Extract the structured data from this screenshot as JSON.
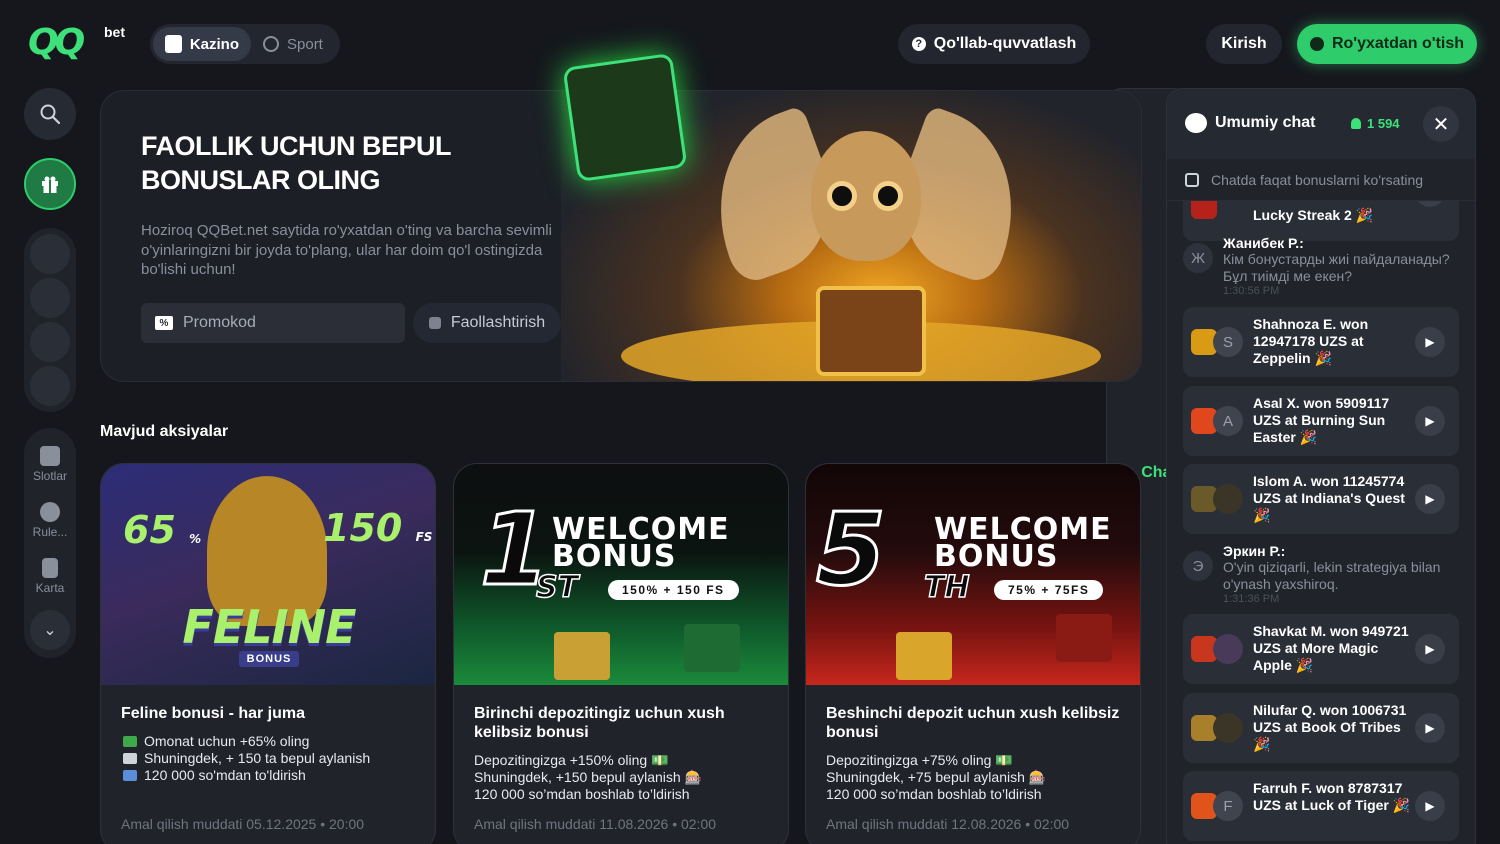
{
  "logo": {
    "brand": "QQ",
    "suffix": "bet"
  },
  "modes": [
    {
      "label": "Kazino",
      "active": true,
      "icon": "cards-icon"
    },
    {
      "label": "Sport",
      "active": false,
      "icon": "ball-icon"
    }
  ],
  "header": {
    "support_label": "Qo'llab-quvvatlash",
    "chat_label": "Chat",
    "login_label": "Kirish",
    "register_label": "Ro'yxatdan o'tish"
  },
  "sidebar": {
    "items": [
      {
        "label": "Slotlar",
        "icon": "slot-icon"
      },
      {
        "label": "Rule...",
        "icon": "roulette-icon"
      },
      {
        "label": "Karta",
        "icon": "card-icon"
      }
    ]
  },
  "hero": {
    "title": "FAOLLIK UCHUN BEPUL BONUSLAR OLING",
    "description": "Hoziroq QQBet.net saytida ro'yxatdan o'ting va barcha sevimli o'yinlaringizni bir joyda to'plang, ular har doim qo'l ostingizda bo'lishi uchun!",
    "promo_placeholder": "Promokod",
    "activate_label": "Faollashtirish"
  },
  "promotions": {
    "section_title": "Mavjud aksiyalar",
    "cards": [
      {
        "art": {
          "left": "65",
          "left_unit": "%",
          "right": "150",
          "right_unit": "FS",
          "name": "FELINE",
          "tag": "BONUS"
        },
        "title": "Feline bonusi - har juma",
        "lines": [
          "Omonat uchun +65% oling",
          "Shuningdek, + 150 ta bepul aylanish",
          "120 000 so'mdan to'ldirish"
        ],
        "deadline": "Amal qilish muddati 05.12.2025 • 20:00"
      },
      {
        "art": {
          "num": "1",
          "ordinal": "ST",
          "line1": "WELCOME",
          "line2": "BONUS",
          "pill": "150% + 150 FS"
        },
        "title": "Birinchi depozitingiz uchun xush kelibsiz bonusi",
        "lines": [
          "Depozitingizga +150% oling 💵",
          "Shuningdek, +150 bepul aylanish 🎰",
          "120 000 so’mdan boshlab to’ldirish"
        ],
        "deadline": "Amal qilish muddati 11.08.2026 • 02:00"
      },
      {
        "art": {
          "num": "5",
          "ordinal": "TH",
          "line1": "WELCOME",
          "line2": "BONUS",
          "pill": "75% + 75FS"
        },
        "title": "Beshinchi depozit uchun xush kelibsiz bonusi",
        "lines": [
          "Depozitingizga +75% oling 💵",
          "Shuningdek, +75 bepul aylanish 🎰",
          "120 000 so’mdan boshlab to’ldirish"
        ],
        "deadline": "Amal qilish muddati 12.08.2026 • 02:00"
      }
    ]
  },
  "chat": {
    "title": "Umumiy chat",
    "online_count": "1 594",
    "filter_label": "Chatda faqat bonuslarni ko'rsating",
    "feed": [
      {
        "type": "win",
        "text": "Lucky Streak 2 🎉",
        "initial": "",
        "thumb": "#b4221a"
      },
      {
        "type": "msg",
        "initial": "Ж",
        "name": "Жанибек Р.:",
        "text": "Кім бонустарды жиі пайдаланады? Бұл тиімді ме екен?",
        "time": "1:30:56 PM"
      },
      {
        "type": "win",
        "text": "Shahnoza E. won 12947178 UZS at Zeppelin 🎉",
        "initial": "S",
        "thumb": "#d99a14"
      },
      {
        "type": "win",
        "text": "Asal X. won 5909117 UZS at Burning Sun Easter 🎉",
        "initial": "A",
        "thumb": "#e0471c"
      },
      {
        "type": "win",
        "text": "Islom A. won 11245774 UZS at Indiana's Quest 🎉",
        "initial": "",
        "thumb": "#6a5a2a"
      },
      {
        "type": "msg",
        "initial": "Э",
        "name": "Эркин Р.:",
        "text": "O'yin qiziqarli, lekin strategiya bilan o'ynash yaxshiroq.",
        "time": "1:31:36 PM"
      },
      {
        "type": "win",
        "text": "Shavkat M. won 949721 UZS at More Magic Apple 🎉",
        "initial": "",
        "thumb": "#c8361e"
      },
      {
        "type": "win",
        "text": "Nilufar Q. won 1006731 UZS at Book Of Tribes 🎉",
        "initial": "",
        "thumb": "#a87f2a"
      },
      {
        "type": "win",
        "text": "Farruh F. won 8787317 UZS at Luck of Tiger 🎉",
        "initial": "F",
        "thumb": "#e0541c"
      }
    ]
  }
}
